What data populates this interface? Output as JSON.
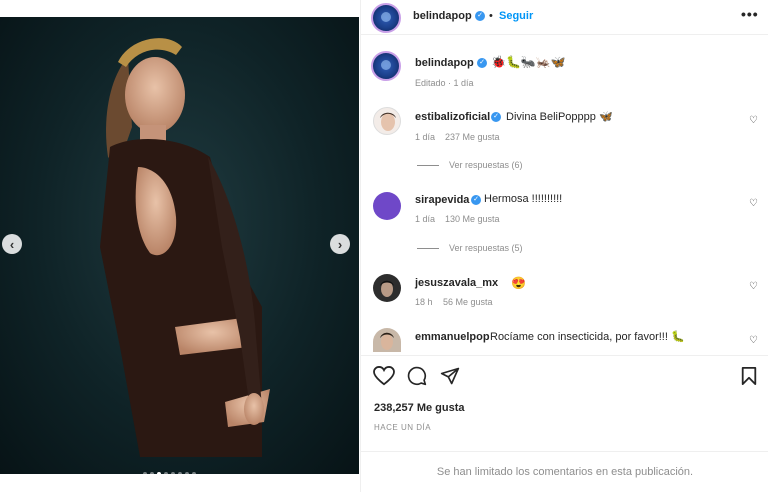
{
  "post": {
    "username": "belindapop",
    "follow_label": "Seguir",
    "separator": "•",
    "more_icon": "•••"
  },
  "caption": {
    "username": "belindapop",
    "emojis": "🐞🐛🐜🦗🦋",
    "meta": "Editado · 1 día"
  },
  "comments": [
    {
      "username": "estibalizoficial",
      "text": "Divina BeliPopppp 🦋",
      "time": "1 día",
      "likes": "237 Me gusta",
      "replies": "Ver respuestas (6)",
      "verified": true
    },
    {
      "username": "sirapevida",
      "text": "Hermosa !!!!!!!!!!",
      "time": "1 día",
      "likes": "130 Me gusta",
      "replies": "Ver respuestas (5)",
      "verified": true
    },
    {
      "username": "jesuszavala_mx",
      "text": "😍",
      "time": "18 h",
      "likes": "56 Me gusta",
      "verified": false
    },
    {
      "username": "emmanuelpop",
      "text": "Rocíame con insecticida, por favor!!! 🐛",
      "verified": false
    }
  ],
  "likes": "238,257 Me gusta",
  "date": "HACE UN DÍA",
  "comments_limited": "Se han limitado los comentarios en esta publicación.",
  "icons": {
    "prev": "‹",
    "next": "›",
    "heart_small": "♡"
  },
  "carousel": {
    "count": 8,
    "active": 2
  },
  "colors": {
    "accent": "#0095f6",
    "verified": "#3897f0",
    "muted": "#8e8e8e"
  }
}
